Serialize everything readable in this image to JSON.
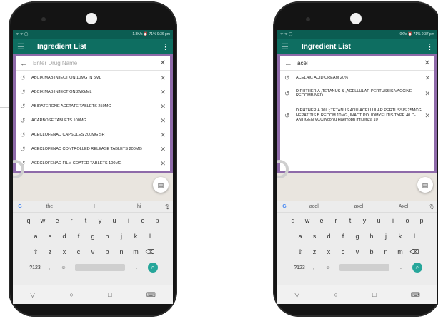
{
  "left_phone": {
    "status": {
      "left": "ᯤ ᯤ ◯",
      "right": "1.8K/s  ⏰  71%  9:36 pm"
    },
    "appbar": {
      "menu_icon": "menu-icon",
      "title": "Ingredient List",
      "more_icon": "more-icon"
    },
    "search": {
      "placeholder": "Enter Drug Name",
      "value": ""
    },
    "suggestions": [
      "ABCIXIMAB INJECTION 10MG IN 5ML",
      "ABCIXIMAB INJECTION 2MG/ML",
      "ABIRATERONE ACETATE TABLETS 250MG",
      "ACARBOSE TABLETS 100MG",
      "ACECLOFENAC CAPSULES 200MG SR",
      "ACECLOFENAC CONTROLLED RELEASE TABLETS 200MG",
      "ACECLOFENAC FILM COATED TABLETS 100MG"
    ],
    "keyboard": {
      "suggestions": [
        "the",
        "I",
        "hi"
      ],
      "row1": [
        "q",
        "w",
        "e",
        "r",
        "t",
        "y",
        "u",
        "i",
        "o",
        "p"
      ],
      "row2": [
        "a",
        "s",
        "d",
        "f",
        "g",
        "h",
        "j",
        "k",
        "l"
      ],
      "row3": [
        "⇧",
        "z",
        "x",
        "c",
        "v",
        "b",
        "n",
        "m",
        "⌫"
      ],
      "row4": {
        "symbols": "?123",
        "comma": ",",
        "emoji": "☺",
        "dot": "."
      }
    }
  },
  "right_phone": {
    "status": {
      "left": "ᯤ ᯤ ◯",
      "right": "0K/s  ⏰  71%  9:37 pm"
    },
    "appbar": {
      "menu_icon": "menu-icon",
      "title": "Ingredient List",
      "more_icon": "more-icon"
    },
    "search": {
      "placeholder": "",
      "value": "acel"
    },
    "suggestions": [
      "ACELAIC ACID CREAM 20%",
      "DIPHTHERIA ,TETANUS & ,ACELLULAR PERTUSSIS VACCINE RECOMBINED",
      "DIPHTHERIA 30IU;TETANUS 40IU,ACELLULAR PERTUSSIS 25MCG, HEPATITIS B RECOM 10MG, INACT POLIOMYELITIS TYPE 40 D-ANTIGEN VCCINconju Haemoph influenza 10"
    ],
    "keyboard": {
      "suggestions": [
        "acel",
        "axel",
        "Axel"
      ],
      "row1": [
        "q",
        "w",
        "e",
        "r",
        "t",
        "y",
        "u",
        "i",
        "o",
        "p"
      ],
      "row2": [
        "a",
        "s",
        "d",
        "f",
        "g",
        "h",
        "j",
        "k",
        "l"
      ],
      "row3": [
        "⇧",
        "z",
        "x",
        "c",
        "v",
        "b",
        "n",
        "m",
        "⌫"
      ],
      "row4": {
        "symbols": "?123",
        "comma": ",",
        "emoji": "☺",
        "dot": "."
      }
    }
  },
  "nav": {
    "back": "▽",
    "home": "○",
    "recent": "□",
    "keyboard": "⌨"
  },
  "colors": {
    "appbar": "#0e6e61",
    "accent": "#26a69a",
    "overlay": "#8e6aa9"
  }
}
